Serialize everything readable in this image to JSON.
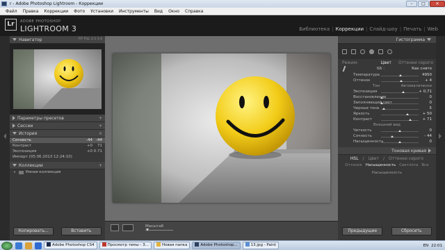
{
  "titlebar": {
    "title": "r - Adobe Photoshop Lightroom - Коррекции"
  },
  "menu": [
    "Файл",
    "Правка",
    "Коррекции",
    "Фото",
    "Установки",
    "Инструменты",
    "Вид",
    "Окно",
    "Справка"
  ],
  "brand": {
    "logo": "Lr",
    "line1": "ADOBE PHOTOSHOP",
    "line2": "LIGHTROOM 3"
  },
  "modules": {
    "items": [
      "Библиотека",
      "Коррекции",
      "Слайд-шоу",
      "Печать",
      "Web"
    ],
    "active": "Коррекции"
  },
  "left": {
    "navigator": {
      "label": "Навигатор",
      "zoom": "FIT  FILL  1:1  1:4"
    },
    "presets": "Параметры пресетов",
    "sessions": "Сессии",
    "history": {
      "label": "История",
      "rows": [
        {
          "name": "Сочность",
          "a": "-44",
          "b": "-44",
          "selected": true
        },
        {
          "name": "Контраст",
          "a": "+0",
          "b": "71"
        },
        {
          "name": "Экспозиция",
          "a": "+0",
          "b": "0.71"
        },
        {
          "name": "Импорт (05.06.2013 12:24:10)",
          "a": "",
          "b": ""
        }
      ]
    },
    "collections": {
      "label": "Коллекции",
      "item": "Умная коллекция"
    },
    "copy": "Копировать...",
    "paste": "Вставить"
  },
  "toolbar": {
    "zoom_label": "Масштаб"
  },
  "right": {
    "histogram": "Гистограмма",
    "mode_label": "Режим:",
    "mode_color": "Цвет",
    "mode_gray": "Оттенки серого",
    "wb_label": "ББ :",
    "wb_value": "Как снято",
    "rows": [
      {
        "id": "temp",
        "label": "Температура",
        "value": "4950",
        "pos": 0.52
      },
      {
        "id": "tint",
        "label": "Оттенок",
        "value": "+ 4",
        "pos": 0.53
      },
      {
        "id": "exp",
        "label": "Экспозиция",
        "value": "+ 0,71",
        "pos": 0.6
      },
      {
        "id": "rec",
        "label": "Восстановление",
        "value": "0",
        "pos": 0.02
      },
      {
        "id": "fill",
        "label": "Заполняющий свет",
        "value": "0",
        "pos": 0.02
      },
      {
        "id": "blk",
        "label": "Черные тона",
        "value": "5",
        "pos": 0.08
      },
      {
        "id": "bri",
        "label": "Яркость",
        "value": "+ 50",
        "pos": 0.7
      },
      {
        "id": "con",
        "label": "Контраст",
        "value": "+ 71",
        "pos": 0.78
      },
      {
        "id": "cla",
        "label": "Четкость",
        "value": "0",
        "pos": 0.5
      },
      {
        "id": "vib",
        "label": "Сочность",
        "value": "- 44",
        "pos": 0.3
      },
      {
        "id": "sat",
        "label": "Насыщенность",
        "value": "0",
        "pos": 0.5
      }
    ],
    "tone_label": "Тон",
    "tone_auto": "Автоматически",
    "presence": "Внешний вид",
    "tone_curve": "Тоновая кривая",
    "hsl_tabs": [
      "HSL",
      "/",
      "Цвет",
      "/",
      "Оттенки серого"
    ],
    "hsl_sub": [
      "Оттенок",
      "Насыщенность",
      "Светлота",
      "Все"
    ],
    "hsl_active": "Насыщенность",
    "hsl_row": "Насыщенность",
    "prev": "Предыдущие",
    "reset": "Сбросить"
  },
  "taskbar": {
    "tasks": [
      "Adobe Photoshop CS4",
      "Просмотр темы - З...",
      "Новая папка",
      "Adobe Photoshop...",
      "13.jpg - Paint"
    ],
    "lang": "EN",
    "time": "22:01"
  },
  "colors": {
    "smiley": "#f0c91a",
    "accent": "#e0e0e0"
  }
}
